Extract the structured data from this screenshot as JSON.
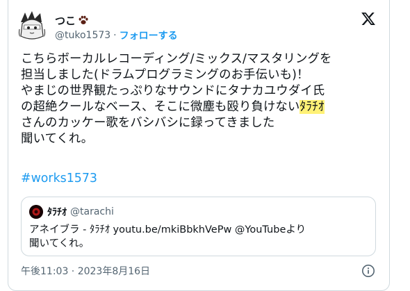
{
  "author": {
    "display_name": "つこ",
    "handle": "@tuko1573",
    "separator": "·",
    "follow_label": "フォローする",
    "name_icon": "paw-icon"
  },
  "brand_icon": "x-logo-icon",
  "tweet": {
    "lines": [
      "こちらボーカルレコーディング/ミックス/マスタリングを",
      "担当しました(ドラムプログラミングのお手伝いも)！",
      "やまじの世界観たっぷりなサウンドにタナカユウダイ氏",
      "の超絶クールなベース、そこに微塵も殴り負けない",
      "さんのカッケー歌をバシバシに録ってきました",
      "聞いてくれ。"
    ],
    "highlight_text": "ﾀﾗﾁｵ",
    "hashtag": "#works1573"
  },
  "quote": {
    "name": "ﾀﾗﾁｵ",
    "handle": "@tarachi",
    "lines": [
      "アネイブラ - ﾀﾗﾁｵ youtu.be/mkiBbkhVePw @YouTubeより",
      "聞いてくれ。"
    ]
  },
  "timestamp": "午後11:03 · 2023年8月16日",
  "info_icon": "info-icon",
  "colors": {
    "link": "#1d9bf0",
    "secondary_text": "#536471",
    "border": "#cfd9de",
    "highlight": "#fff176"
  }
}
